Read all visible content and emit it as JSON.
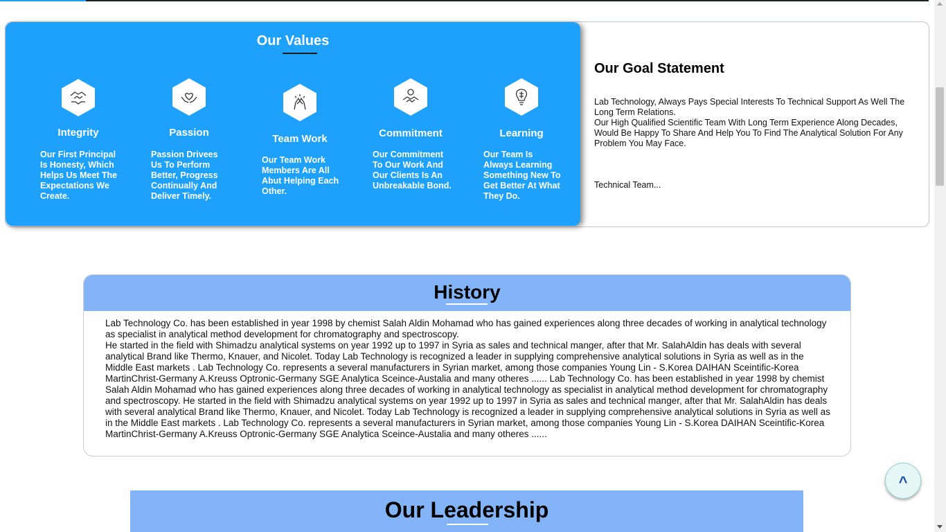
{
  "values": {
    "title": "Our Values",
    "items": [
      {
        "icon": "handshake-icon",
        "name": "Integrity",
        "desc": "Our First Principal Is Honesty, Which Helps Us Meet The Expectations We Create."
      },
      {
        "icon": "heart-hands-icon",
        "name": "Passion",
        "desc": "Passion Drivees Us To Perform Better, Progress Continually And Deliver Timely."
      },
      {
        "icon": "team-hands-icon",
        "name": "Team Work",
        "desc": "Our Team Work Members Are All Abut Helping Each Other."
      },
      {
        "icon": "commitment-handshake-icon",
        "name": "Commitment",
        "desc": "Our Commitment To Our Work And Our Clients Is An Unbreakable Bond."
      },
      {
        "icon": "brain-bulb-icon",
        "name": "Learning",
        "desc": "Our Team Is Always Learning Something New To Get Better At What They Do."
      }
    ]
  },
  "goal": {
    "title": "Our Goal Statement",
    "paragraph1": "Lab Technology, Always Pays Special Interests To Technical Support As Well The Long Term Relations.",
    "paragraph2": "Our High Qualified Scientific Team With Long Term Experience Along Decades, Would Be Happy To Share And Help You To Find The Analytical Solution For Any Problem You May Face.",
    "signature": "Technical Team..."
  },
  "history": {
    "title": "History",
    "line1": "Lab Technology Co. has been established in year 1998 by chemist Salah Aldin Mohamad who has gained experiences along three decades of working in analytical technology as specialist in analytical method development for chromatography and spectroscopy.",
    "line2": "He started in the field with Shimadzu analytical systems on year 1992 up to 1997 in Syria as sales and technical manger, after that Mr. SalahAldin has deals with several analytical Brand like Thermo, Knauer, and Nicolet. Today Lab Technology is recognized a leader in supplying comprehensive analytical solutions in Syria as well as in the Middle East markets . Lab Technology Co. represents a several manufacturers in Syrian market, among those companies Young Lin - S.Korea DAIHAN Sceintific-Korea MartinChrist-Germany A.Kreuss Optronic-Germany SGE Analytica Sceince-Austalia and many otheres ...... Lab Technology Co. has been established in year 1998 by chemist Salah Aldin Mohamad who has gained experiences along three decades of working in analytical technology as specialist in analytical method development for chromatography and spectroscopy. He started in the field with Shimadzu analytical systems on year 1992 up to 1997 in Syria as sales and technical manger, after that Mr. SalahAldin has deals with several analytical Brand like Thermo, Knauer, and Nicolet. Today Lab Technology is recognized a leader in supplying comprehensive analytical solutions in Syria as well as in the Middle East markets . Lab Technology Co. represents a several manufacturers in Syrian market, among those companies Young Lin - S.Korea DAIHAN Sceintific-Korea MartinChrist-Germany A.Kreuss Optronic-Germany SGE Analytica Sceince-Austalia and many otheres ......"
  },
  "leadership": {
    "title": "Our Leadership"
  },
  "back_to_top": {
    "label": "^"
  },
  "colors": {
    "values_bg": "#1da1fb",
    "header_bg": "#84b4f8",
    "back_to_top_arrow": "#1b4fa8"
  }
}
